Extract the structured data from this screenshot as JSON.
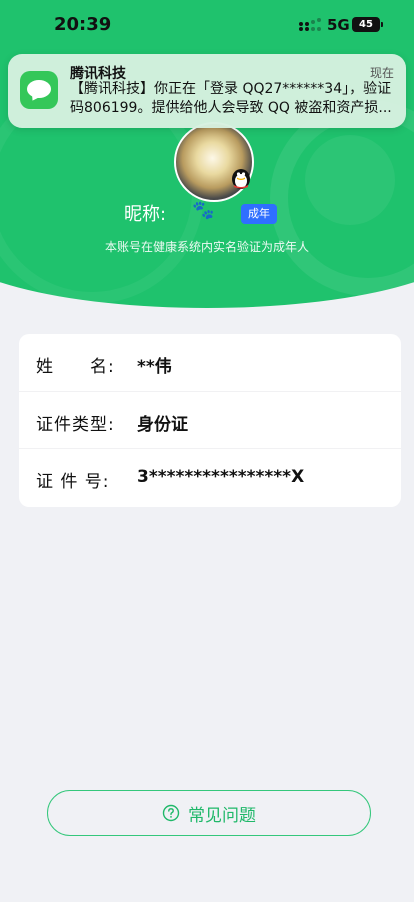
{
  "status_bar": {
    "time": "20:39",
    "network": "5G",
    "battery": "45"
  },
  "notification": {
    "app": "腾讯科技",
    "time": "现在",
    "body": "【腾讯科技】你正在「登录 QQ27******34」，验证码806199。提供给他人会导致 QQ 被盗和资产损..."
  },
  "profile": {
    "nickname_label": "昵称:",
    "nickname_value": "🐾",
    "adult_badge": "成年",
    "verify_note": "本账号在健康系统内实名验证为成年人"
  },
  "info_rows": [
    {
      "label": "姓　　名:",
      "value": "**伟"
    },
    {
      "label": "证件类型:",
      "value": "身份证"
    },
    {
      "label": "证 件 号:",
      "value": "3****************X"
    }
  ],
  "faq": {
    "label": "常见问题"
  },
  "colors": {
    "brand_green": "#1fc26d",
    "badge_blue": "#2f6fff",
    "faq_text_green": "#1fb869"
  },
  "icons": {
    "qq_badge": "qq-penguin-icon",
    "faq": "question-circle-icon",
    "messages": "messages-app-icon"
  }
}
